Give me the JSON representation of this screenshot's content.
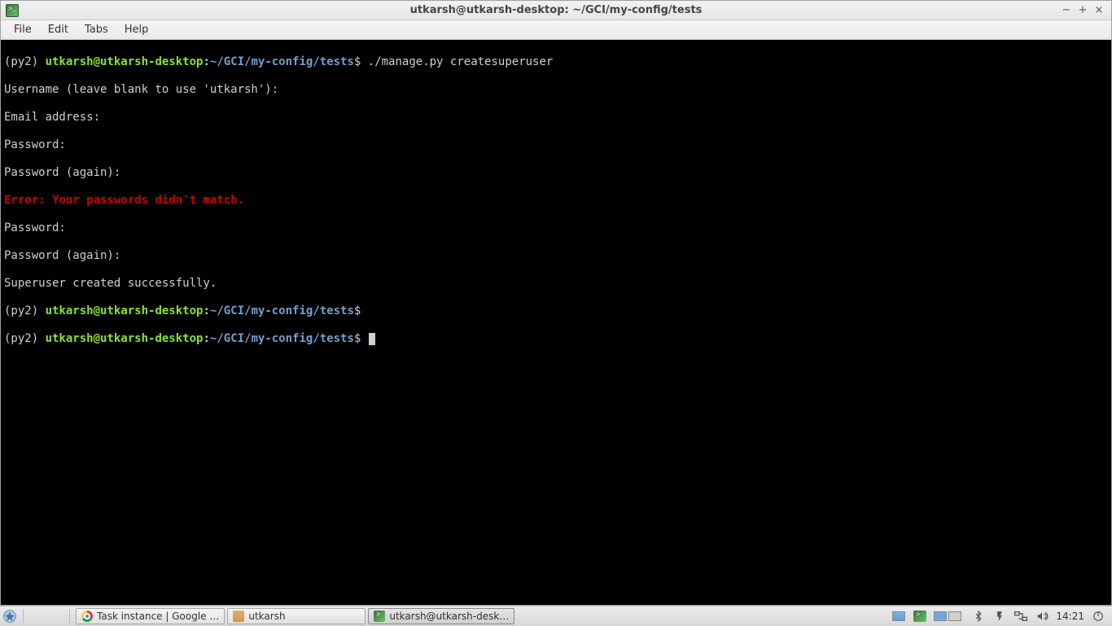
{
  "window": {
    "title": "utkarsh@utkarsh-desktop: ~/GCI/my-config/tests"
  },
  "menubar": {
    "file": "File",
    "edit": "Edit",
    "tabs": "Tabs",
    "help": "Help"
  },
  "prompt": {
    "env": "(py2) ",
    "user_host": "utkarsh@utkarsh-desktop",
    "colon": ":",
    "path": "~/GCI/my-config/tests",
    "dollar": "$"
  },
  "terminal": {
    "cmd1": " ./manage.py createsuperuser",
    "line_username": "Username (leave blank to use 'utkarsh'):",
    "line_email": "Email address:",
    "line_pw1": "Password:",
    "line_pw2": "Password (again):",
    "line_error": "Error: Your passwords didn't match.",
    "line_pw3": "Password:",
    "line_pw4": "Password (again):",
    "line_success": "Superuser created successfully."
  },
  "taskbar": {
    "task1": "Task instance | Google …",
    "task2": "utkarsh",
    "task3": "utkarsh@utkarsh-desk…",
    "clock": "14:21"
  }
}
